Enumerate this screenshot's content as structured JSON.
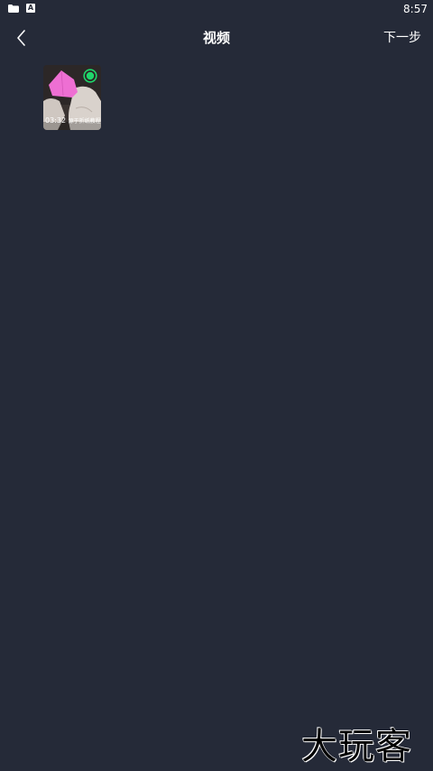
{
  "status_bar": {
    "time": "8:57",
    "left_icons": [
      "folder-icon",
      "a-badge-icon"
    ],
    "a_badge_text": "A"
  },
  "nav": {
    "back_icon": "chevron-left-icon",
    "title": "视频",
    "next_label": "下一步"
  },
  "videos": [
    {
      "duration": "03:32",
      "caption": "源于折纸教程",
      "selected": true
    }
  ],
  "colors": {
    "background": "#252a38",
    "select_accent": "#1fd76b",
    "paper_pink": "#ee6fd3"
  },
  "watermark": "大玩客"
}
